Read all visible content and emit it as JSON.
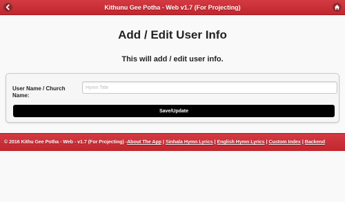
{
  "header": {
    "title": "Kithunu Gee Potha - Web v1.7 (For Projecting)",
    "back_icon": "chevron-left-icon",
    "home_icon": "home-icon"
  },
  "main": {
    "title": "Add / Edit User Info",
    "subtitle": "This will add / edit user info.",
    "form": {
      "field_label": "User Name / Church Name:",
      "field_placeholder": "Hymn Title",
      "field_value": "",
      "save_label": "Save/Update"
    }
  },
  "footer": {
    "copyright": "© 2016 Kithu Gee Potha - Web - v1.7 (For Projecting) - ",
    "links": [
      "About The App",
      "Sinhala Hymn Lyrics",
      "English Hymn Lyrics",
      "Custom Index",
      "Backend"
    ],
    "separator": "|"
  },
  "colors": {
    "bar": "#c8303a",
    "page_bg": "#f9f9f9",
    "button_bg": "#000000"
  }
}
